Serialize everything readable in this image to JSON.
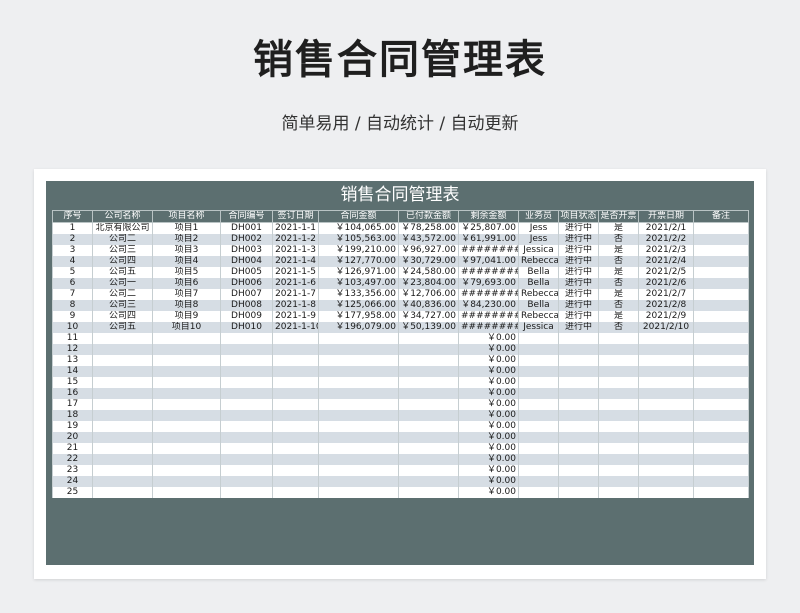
{
  "hero": {
    "title": "销售合同管理表",
    "subtitle": "简单易用 / 自动统计 / 自动更新"
  },
  "sheet": {
    "title": "销售合同管理表",
    "headers": [
      "序号",
      "公司名称",
      "项目名称",
      "合同编号",
      "签订日期",
      "合同金额",
      "已付款金额",
      "剩余金额",
      "业务员",
      "项目状态",
      "是否开票",
      "开票日期",
      "备注"
    ],
    "rows": [
      [
        "1",
        "北京有限公司",
        "项目1",
        "DH001",
        "2021-1-1",
        "￥104,065.00",
        "￥78,258.00",
        "￥25,807.00",
        "Jess",
        "进行中",
        "是",
        "2021/2/1",
        ""
      ],
      [
        "2",
        "公司二",
        "项目2",
        "DH002",
        "2021-1-2",
        "￥105,563.00",
        "￥43,572.00",
        "￥61,991.00",
        "Jess",
        "进行中",
        "否",
        "2021/2/2",
        ""
      ],
      [
        "3",
        "公司三",
        "项目3",
        "DH003",
        "2021-1-3",
        "￥199,210.00",
        "￥96,927.00",
        "###########",
        "Jessica",
        "进行中",
        "是",
        "2021/2/3",
        ""
      ],
      [
        "4",
        "公司四",
        "项目4",
        "DH004",
        "2021-1-4",
        "￥127,770.00",
        "￥30,729.00",
        "￥97,041.00",
        "Rebecca",
        "进行中",
        "否",
        "2021/2/4",
        ""
      ],
      [
        "5",
        "公司五",
        "项目5",
        "DH005",
        "2021-1-5",
        "￥126,971.00",
        "￥24,580.00",
        "###########",
        "Bella",
        "进行中",
        "是",
        "2021/2/5",
        ""
      ],
      [
        "6",
        "公司一",
        "项目6",
        "DH006",
        "2021-1-6",
        "￥103,497.00",
        "￥23,804.00",
        "￥79,693.00",
        "Bella",
        "进行中",
        "否",
        "2021/2/6",
        ""
      ],
      [
        "7",
        "公司二",
        "项目7",
        "DH007",
        "2021-1-7",
        "￥133,356.00",
        "￥12,706.00",
        "###########",
        "Rebecca",
        "进行中",
        "是",
        "2021/2/7",
        ""
      ],
      [
        "8",
        "公司三",
        "项目8",
        "DH008",
        "2021-1-8",
        "￥125,066.00",
        "￥40,836.00",
        "￥84,230.00",
        "Bella",
        "进行中",
        "否",
        "2021/2/8",
        ""
      ],
      [
        "9",
        "公司四",
        "项目9",
        "DH009",
        "2021-1-9",
        "￥177,958.00",
        "￥34,727.00",
        "###########",
        "Rebecca",
        "进行中",
        "是",
        "2021/2/9",
        ""
      ],
      [
        "10",
        "公司五",
        "项目10",
        "DH010",
        "2021-1-10",
        "￥196,079.00",
        "￥50,139.00",
        "###########",
        "Jessica",
        "进行中",
        "否",
        "2021/2/10",
        ""
      ],
      [
        "11",
        "",
        "",
        "",
        "",
        "",
        "",
        "￥0.00",
        "",
        "",
        "",
        "",
        ""
      ],
      [
        "12",
        "",
        "",
        "",
        "",
        "",
        "",
        "￥0.00",
        "",
        "",
        "",
        "",
        ""
      ],
      [
        "13",
        "",
        "",
        "",
        "",
        "",
        "",
        "￥0.00",
        "",
        "",
        "",
        "",
        ""
      ],
      [
        "14",
        "",
        "",
        "",
        "",
        "",
        "",
        "￥0.00",
        "",
        "",
        "",
        "",
        ""
      ],
      [
        "15",
        "",
        "",
        "",
        "",
        "",
        "",
        "￥0.00",
        "",
        "",
        "",
        "",
        ""
      ],
      [
        "16",
        "",
        "",
        "",
        "",
        "",
        "",
        "￥0.00",
        "",
        "",
        "",
        "",
        ""
      ],
      [
        "17",
        "",
        "",
        "",
        "",
        "",
        "",
        "￥0.00",
        "",
        "",
        "",
        "",
        ""
      ],
      [
        "18",
        "",
        "",
        "",
        "",
        "",
        "",
        "￥0.00",
        "",
        "",
        "",
        "",
        ""
      ],
      [
        "19",
        "",
        "",
        "",
        "",
        "",
        "",
        "￥0.00",
        "",
        "",
        "",
        "",
        ""
      ],
      [
        "20",
        "",
        "",
        "",
        "",
        "",
        "",
        "￥0.00",
        "",
        "",
        "",
        "",
        ""
      ],
      [
        "21",
        "",
        "",
        "",
        "",
        "",
        "",
        "￥0.00",
        "",
        "",
        "",
        "",
        ""
      ],
      [
        "22",
        "",
        "",
        "",
        "",
        "",
        "",
        "￥0.00",
        "",
        "",
        "",
        "",
        ""
      ],
      [
        "23",
        "",
        "",
        "",
        "",
        "",
        "",
        "￥0.00",
        "",
        "",
        "",
        "",
        ""
      ],
      [
        "24",
        "",
        "",
        "",
        "",
        "",
        "",
        "￥0.00",
        "",
        "",
        "",
        "",
        ""
      ],
      [
        "25",
        "",
        "",
        "",
        "",
        "",
        "",
        "￥0.00",
        "",
        "",
        "",
        "",
        ""
      ]
    ]
  },
  "colors": {
    "frame": "#5c6f70",
    "row_alt": "#d6dde4",
    "page_bg": "#eeeff1"
  }
}
